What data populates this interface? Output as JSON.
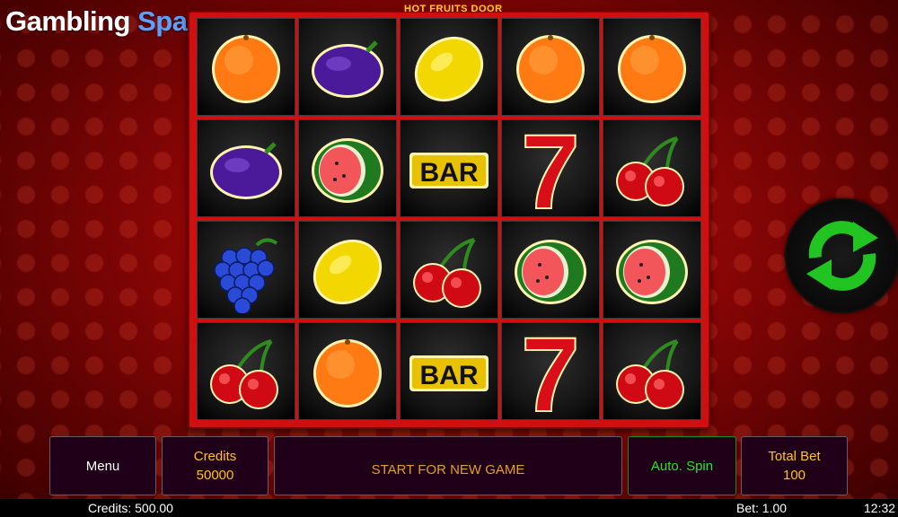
{
  "brand": {
    "word1": "Gambling",
    "word2": "Space"
  },
  "game_title": "HOT FRUITS DOOR",
  "reels": [
    [
      "orange",
      "plum",
      "lemon",
      "orange",
      "orange"
    ],
    [
      "plum",
      "watermelon",
      "bar",
      "seven",
      "cherry"
    ],
    [
      "grapes",
      "lemon",
      "cherry",
      "watermelon",
      "watermelon"
    ],
    [
      "cherry",
      "orange",
      "bar",
      "seven",
      "cherry"
    ]
  ],
  "symbols": {
    "bar_label": "BAR",
    "seven_label": "7"
  },
  "spin_button": {
    "icon": "refresh-arrows-icon",
    "color": "#22c422"
  },
  "controls": {
    "menu_label": "Menu",
    "credits_label": "Credits",
    "credits_value": "50000",
    "message": "START FOR NEW GAME",
    "autospin_label": "Auto. Spin",
    "totalbet_label": "Total Bet",
    "totalbet_value": "100"
  },
  "status": {
    "credits": "Credits: 500.00",
    "bet": "Bet: 1.00",
    "time": "12:32"
  },
  "colors": {
    "accent_gold": "#ffc21a",
    "autospin_green": "#27e527",
    "frame_red": "#d01010"
  }
}
